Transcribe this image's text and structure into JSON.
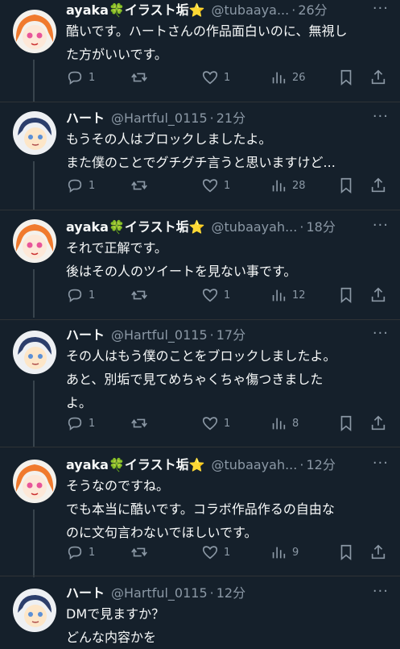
{
  "accent": "#1d9bf0",
  "users": {
    "ayaka": {
      "name": "ayaka",
      "clover": "🍀",
      "suffix": "イラスト垢",
      "star": "⭐"
    },
    "heart": {
      "name": "ハート",
      "handle": "@Hartful_0115"
    }
  },
  "tweets": [
    {
      "handle": "@tubaaya...",
      "time": "26分",
      "text": "酷いです。ハートさんの作品面白いのに、無視し\nた方がいいです。",
      "replies": "1",
      "likes": "1",
      "views": "26"
    },
    {
      "handle": "@Hartful_0115",
      "time": "21分",
      "text": "もうその人はブロックしましたよ。\nまた僕のことでグチグチ言うと思いますけど...",
      "replies": "1",
      "likes": "1",
      "views": "28"
    },
    {
      "handle": "@tubaayah...",
      "time": "18分",
      "text": "それで正解です。\n後はその人のツイートを見ない事です。",
      "replies": "1",
      "likes": "1",
      "views": "12"
    },
    {
      "handle": "@Hartful_0115",
      "time": "17分",
      "text": "その人はもう僕のことをブロックしましたよ。\nあと、別垢で見てめちゃくちゃ傷つきました\nよ。",
      "replies": "1",
      "likes": "1",
      "views": "8"
    },
    {
      "handle": "@tubaayah...",
      "time": "12分",
      "text": "そうなのですね。\nでも本当に酷いです。コラボ作品作るの自由な\nのに文句言わないでほしいです。",
      "replies": "1",
      "likes": "1",
      "views": "9"
    },
    {
      "handle": "@Hartful_0115",
      "time": "12分",
      "text": "DMで見ますか？\nどんな内容かを"
    }
  ]
}
